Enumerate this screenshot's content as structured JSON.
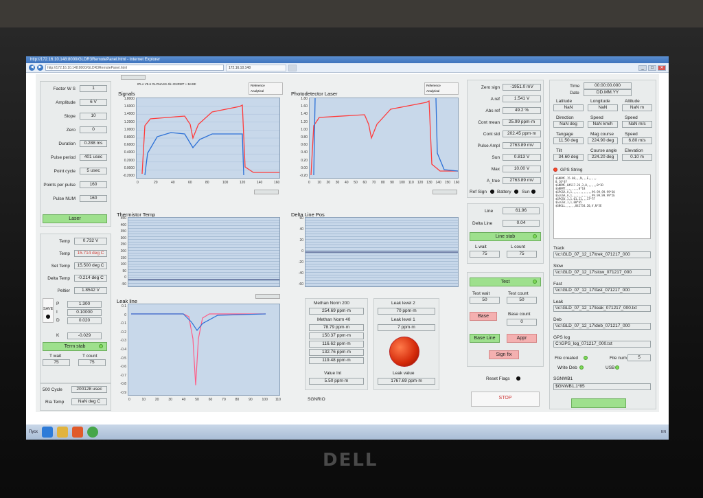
{
  "browser": {
    "title": "http://172.16.10.148:8000/GLDR3RemotePanel.html - Internet Explorer",
    "address": "http://172.16.10.148:8000/GLDR3RemotePanel.html",
    "tab_label": "172.16.10.148"
  },
  "brand": "DELL",
  "left": {
    "params": [
      {
        "label": "Factor W S",
        "value": "1"
      },
      {
        "label": "Amplitude",
        "value": "6 V"
      },
      {
        "label": "Slope",
        "value": "10"
      },
      {
        "label": "Zero",
        "value": "0"
      },
      {
        "label": "Duration",
        "value": "0.288 ms"
      },
      {
        "label": "Pulse period",
        "value": "401 usec"
      },
      {
        "label": "Point cycle",
        "value": "5 usec"
      },
      {
        "label": "Points per pulse",
        "value": "160"
      },
      {
        "label": "Pulse NUM",
        "value": "160"
      }
    ],
    "laser_btn": "Laser",
    "temps": [
      {
        "label": "Temp",
        "value": "0.732 V"
      },
      {
        "label": "Temp",
        "value": "15.714 deg C"
      },
      {
        "label": "Set Temp",
        "value": "15.500 deg C"
      },
      {
        "label": "Delta Temp",
        "value": "-0.214 deg C"
      },
      {
        "label": "Peltier",
        "value": "1.8542 V"
      }
    ],
    "save_btn": "SAVE",
    "pid": [
      {
        "label": "P",
        "value": "1.300"
      },
      {
        "label": "I",
        "value": "0.10000"
      },
      {
        "label": "D",
        "value": "0.020"
      },
      {
        "label": "K",
        "value": "-0.029"
      }
    ],
    "term_stab_btn": "Term stab",
    "t_wait_label": "T wait",
    "t_wait": "75",
    "t_count_label": "T count",
    "t_count": "75",
    "cycle_label": "500 Cycle",
    "cycle_value": "200128 usec",
    "ria_label": "Ria Temp",
    "ria_value": "NaN deg C"
  },
  "charts": {
    "header_note": "IPLA V5.6 GLONASS 4b+GNRMT + BASE",
    "legend_ref": "Reference",
    "legend_ana": "Analytical",
    "signals": {
      "title": "Signals",
      "y_ticks": [
        "1.8000",
        "1.6000",
        "1.4000",
        "1.2000",
        "1.0000",
        "0.8000",
        "0.6000",
        "0.4000",
        "0.2000",
        "0.0000",
        "-0.2000"
      ],
      "x_ticks": [
        "0",
        "20",
        "40",
        "60",
        "80",
        "100",
        "120",
        "140",
        "160"
      ]
    },
    "photo": {
      "title": "Photodetector Laser",
      "y_ticks": [
        "1.80",
        "1.60",
        "1.40",
        "1.20",
        "1.00",
        "0.80",
        "0.60",
        "0.40",
        "0.20",
        "0.00",
        "-0.20"
      ],
      "x_ticks": [
        "0",
        "10",
        "20",
        "30",
        "40",
        "50",
        "60",
        "70",
        "80",
        "90",
        "100",
        "110",
        "120",
        "130",
        "140",
        "150",
        "160"
      ]
    },
    "thermistor": {
      "title": "Thermistor Temp",
      "y_ticks": [
        "450",
        "400",
        "350",
        "300",
        "250",
        "200",
        "150",
        "100",
        "50",
        "0",
        "-50"
      ]
    },
    "delta_line": {
      "title": "Delta Line Pos",
      "y_ticks": [
        "60",
        "40",
        "20",
        "0",
        "-20",
        "-40",
        "-60"
      ]
    },
    "leak": {
      "title": "Leak line",
      "y_ticks": [
        "0.1",
        "0",
        "-0.1",
        "-0.2",
        "-0.3",
        "-0.4",
        "-0.5",
        "-0.6",
        "-0.7",
        "-0.8",
        "-0.9"
      ],
      "x_ticks": [
        "0",
        "10",
        "20",
        "30",
        "40",
        "50",
        "60",
        "70",
        "80",
        "90",
        "100",
        "110"
      ]
    }
  },
  "methan": {
    "norm200_label": "Methan Norm 200",
    "norm200": "254.69 ppm·m",
    "norm40_label": "Methan Norm 40",
    "list": [
      "78.79 ppm·m",
      "150.37 ppm·m",
      "116.62 ppm·m",
      "132.76 ppm·m",
      "119.48 ppm·m"
    ],
    "value_int_label": "Value Int",
    "value_int": "5.50 ppm·m",
    "leak2_label": "Leak level 2",
    "leak2": "70 ppm·m",
    "leak1_label": "Leak level 1",
    "leak1": "7 ppm·m",
    "leak_value_label": "Leak value",
    "leak_value": "1767.69 ppm·m",
    "sgnrio": "SGNRIO"
  },
  "mid": {
    "rows": [
      {
        "label": "Zero sign",
        "value": "-1951.0 mV"
      },
      {
        "label": "A ref",
        "value": "1.541 V"
      },
      {
        "label": "Abs ref",
        "value": "49.2 %"
      },
      {
        "label": "Cont mean",
        "value": "25.99 ppm·m"
      },
      {
        "label": "Cont std",
        "value": "202.45 ppm·m"
      },
      {
        "label": "Pulse Ampl",
        "value": "2763.89 mV"
      },
      {
        "label": "Sun",
        "value": "0.813 V"
      },
      {
        "label": "Max",
        "value": "10.00 V"
      },
      {
        "label": "A_true",
        "value": "2763.89 mV"
      }
    ],
    "ref_sign": "Ref Sign",
    "battery": "Battery",
    "sun": "Sun",
    "line_label": "Line",
    "line": "61.96",
    "delta_line_label": "Delta Line",
    "delta_line": "0.04",
    "line_stab_btn": "Line stab",
    "l_wait_label": "L wait",
    "l_wait": "75",
    "l_count_label": "L count",
    "l_count": "75",
    "test_btn": "Test",
    "test_wait_label": "Test wait",
    "test_wait": "50",
    "test_count_label": "Test count",
    "test_count": "50",
    "base_btn": "Base",
    "base_count_label": "Base count",
    "base_count": "0",
    "base_line_btn": "Base Line",
    "appr_btn": "Appr",
    "sign_fix_btn": "Sign fix",
    "reset_flags": "Reset Flags",
    "stop_btn": "STOP"
  },
  "right": {
    "time_label": "Time",
    "time": "00:00:00.000",
    "date_label": "Date",
    "date": "DD.MM.YY",
    "lat_label": "Latitude",
    "lat": "NaN",
    "lon_label": "Longitude",
    "lon": "NaN",
    "alt_label": "Altitude",
    "alt": "NaN m",
    "dir_label": "Direction",
    "dir": "NaN deg",
    "speed1_label": "Speed",
    "speed1": "NaN km/h",
    "speed2_label": "Speed",
    "speed2": "NaN m/s",
    "tangage_label": "Tangage",
    "tangage": "11.50 deg",
    "mag_label": "Mag course",
    "mag": "224.90 deg",
    "speed3_label": "Speed",
    "speed3": "6.80 m/s",
    "tilt_label": "Tilt",
    "tilt": "34.60 deg",
    "course_angle_label": "Course angle",
    "course_angle": "224.20 deg",
    "elevation_label": "Elevation",
    "elevation": "0.10 m",
    "gps_string_label": "GPS String",
    "gps_lines": "$GNRMC,15.08,,,N,,,E,,,,,\n0.10*4F\n$GNRMC,84517.26,3,0,,,,,,0*1D\n$GNRMT,,,,,,,,0*18\n$GPGSA,A,1,,,,,,,,,,,,99.99,99.99*30\n$GLGSA,A,1,,,,,,,,,,,,99.99,99.99*2E\n$GPGSV,1,1,01,21,,,17*7F\n$GLGSV,1,1,00*65\n$GNGLL,,,,,,842734.20,V,N*5E",
    "track_label": "Track",
    "track": "\\\\c:\\GLD_07_12_17\\trek_071217_000",
    "slow_label": "Slow",
    "slow": "\\\\c:\\GLD_07_12_17\\slow_071217_000",
    "fast_label": "Fast",
    "fast": "\\\\c:\\GLD_07_12_17\\fast_071217_000",
    "leak_label": "Leak",
    "leak": "\\\\c:\\GLD_07_12_17\\leak_071217_000.txt",
    "deb_label": "Deb",
    "deb": "\\\\c:\\GLD_07_12_17\\deb_071217_000",
    "gpslog_label": "GPS log",
    "gpslog": "C:\\GPS_log_071217_000.txt",
    "file_created": "File created",
    "file_num_label": "File num",
    "file_num": "5",
    "write_deb": "Write Deb",
    "usb": "USB",
    "sgnwb_label": "SGNWB1",
    "sgnwb": "$GNWB1,1*85"
  },
  "taskbar": {
    "start": "Пуск",
    "tray": "EN"
  }
}
